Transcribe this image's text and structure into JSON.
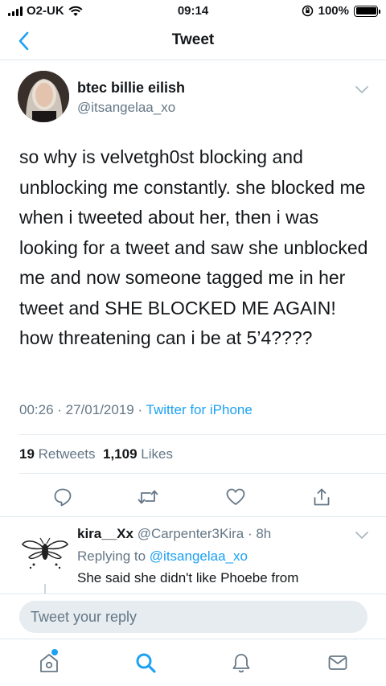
{
  "status_bar": {
    "carrier": "O2-UK",
    "time": "09:14",
    "battery": "100%",
    "battery_level": 1.0
  },
  "nav": {
    "title": "Tweet"
  },
  "tweet": {
    "author_name": "btec billie eilish",
    "author_handle": "@itsangelaa_xo",
    "text": "so why is velvetgh0st blocking and unblocking me constantly. she blocked me when i tweeted about her, then i was looking for a tweet and saw she unblocked me and now someone tagged me in her tweet and SHE BLOCKED ME AGAIN! how threatening can i be at 5’4????",
    "timestamp": "00:26 · 27/01/2019 · ",
    "source": "Twitter for iPhone",
    "retweets_count": "19",
    "retweets_label": "Retweets",
    "likes_count": "1,109",
    "likes_label": "Likes"
  },
  "actions": {
    "reply": "reply-icon",
    "retweet": "retweet-icon",
    "like": "heart-icon",
    "share": "share-icon"
  },
  "reply": {
    "name": "kira__Xx",
    "handle_time": "@Carpenter3Kira · 8h",
    "replying_label": "Replying to ",
    "replying_to": "@itsangelaa_xo",
    "text": "She said she didn't like Phoebe from"
  },
  "compose": {
    "placeholder": "Tweet your reply"
  },
  "tabs": [
    "home-icon",
    "search-icon",
    "notifications-icon",
    "messages-icon"
  ],
  "colors": {
    "accent": "#1da1f2",
    "secondary_text": "#657786",
    "divider": "#e1e8ed"
  }
}
